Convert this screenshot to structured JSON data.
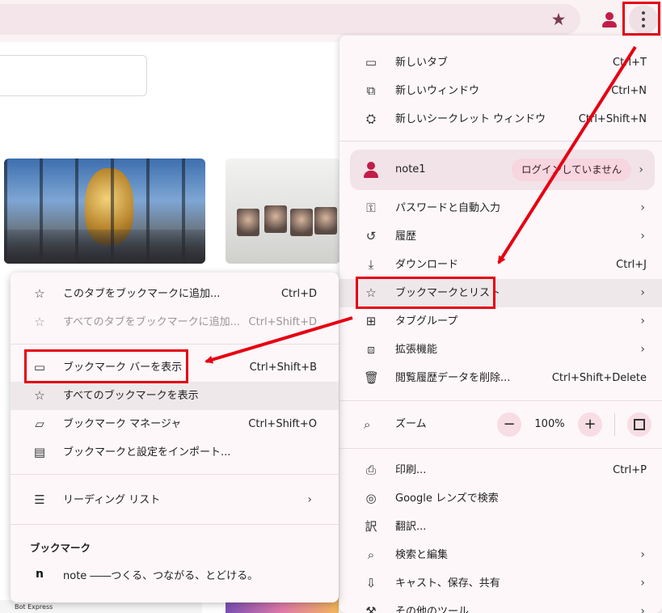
{
  "main_menu": {
    "items": [
      {
        "label": "新しいタブ",
        "shortcut": "Ctrl+T"
      },
      {
        "label": "新しいウィンドウ",
        "shortcut": "Ctrl+N"
      },
      {
        "label": "新しいシークレット ウィンドウ",
        "shortcut": "Ctrl+Shift+N"
      }
    ],
    "profile": {
      "name": "note1",
      "status": "ログインしていません"
    },
    "items2": [
      {
        "label": "パスワードと自動入力"
      },
      {
        "label": "履歴"
      },
      {
        "label": "ダウンロード",
        "shortcut": "Ctrl+J"
      },
      {
        "label": "ブックマークとリスト"
      },
      {
        "label": "タブグループ"
      },
      {
        "label": "拡張機能"
      },
      {
        "label": "閲覧履歴データを削除...",
        "shortcut": "Ctrl+Shift+Delete"
      }
    ],
    "zoom": {
      "label": "ズーム",
      "value": "100%",
      "minus": "−",
      "plus": "+"
    },
    "items3": [
      {
        "label": "印刷...",
        "shortcut": "Ctrl+P"
      },
      {
        "label": "Google レンズで検索"
      },
      {
        "label": "翻訳..."
      },
      {
        "label": "検索と編集"
      },
      {
        "label": "キャスト、保存、共有"
      },
      {
        "label": "その他のツール"
      }
    ],
    "chevron": "›"
  },
  "bookmark_menu": {
    "items": [
      {
        "label": "このタブをブックマークに追加...",
        "shortcut": "Ctrl+D"
      },
      {
        "label": "すべてのタブをブックマークに追加...",
        "shortcut": "Ctrl+Shift+D"
      },
      {
        "label": "ブックマーク バーを表示",
        "shortcut": "Ctrl+Shift+B"
      },
      {
        "label": "すべてのブックマークを表示"
      },
      {
        "label": "ブックマーク マネージャ",
        "shortcut": "Ctrl+Shift+O"
      },
      {
        "label": "ブックマークと設定をインポート..."
      },
      {
        "label": "リーディング リスト"
      }
    ],
    "heading": "ブックマーク",
    "bookmark_item": "note ――つくる、つながる、とどける。",
    "bookmark_icon_glyph": "n",
    "chevron": "›"
  },
  "page_behind": {
    "footer_text": "Bot Express"
  },
  "colors": {
    "highlight_box": "#e60012",
    "profile_accent": "#c21d4a",
    "menu_bg": "#fdf7fa"
  },
  "icons": [
    "star-icon",
    "profile-icon",
    "more-vert-icon",
    "new-tab-icon",
    "new-window-icon",
    "incognito-icon",
    "key-icon",
    "history-icon",
    "download-icon",
    "bookmark-star-icon",
    "tab-groups-icon",
    "extension-icon",
    "trash-icon",
    "zoom-icon",
    "fullscreen-icon",
    "print-icon",
    "lens-icon",
    "translate-icon",
    "search-edit-icon",
    "cast-icon",
    "tools-icon",
    "bookmark-bar-icon",
    "bookmarks-all-icon",
    "folder-edit-icon",
    "import-book-icon",
    "reading-list-icon",
    "note-logo-icon"
  ]
}
